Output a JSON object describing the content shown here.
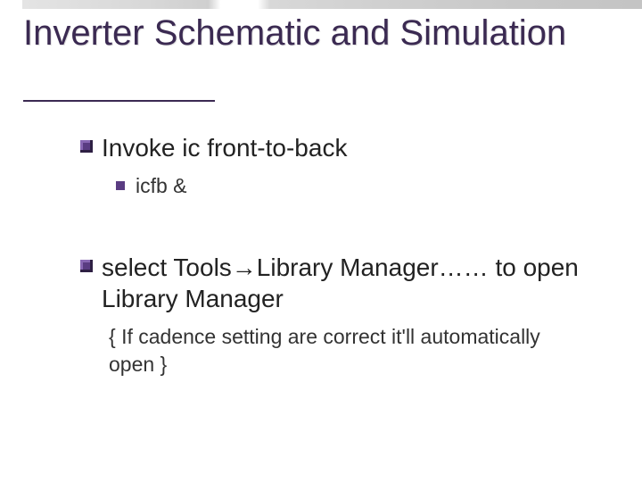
{
  "title": "Inverter Schematic and Simulation",
  "items": [
    {
      "level": 1,
      "text": "Invoke ic front-to-back"
    },
    {
      "level": 2,
      "text": "icfb &"
    },
    {
      "level": 0,
      "gap": true
    },
    {
      "level": 1,
      "text_parts": [
        "select Tools",
        "→",
        "Library Manager…… to open Library Manager"
      ]
    },
    {
      "level": 3,
      "text": "{ If cadence setting are correct it'll automatically open }"
    }
  ]
}
